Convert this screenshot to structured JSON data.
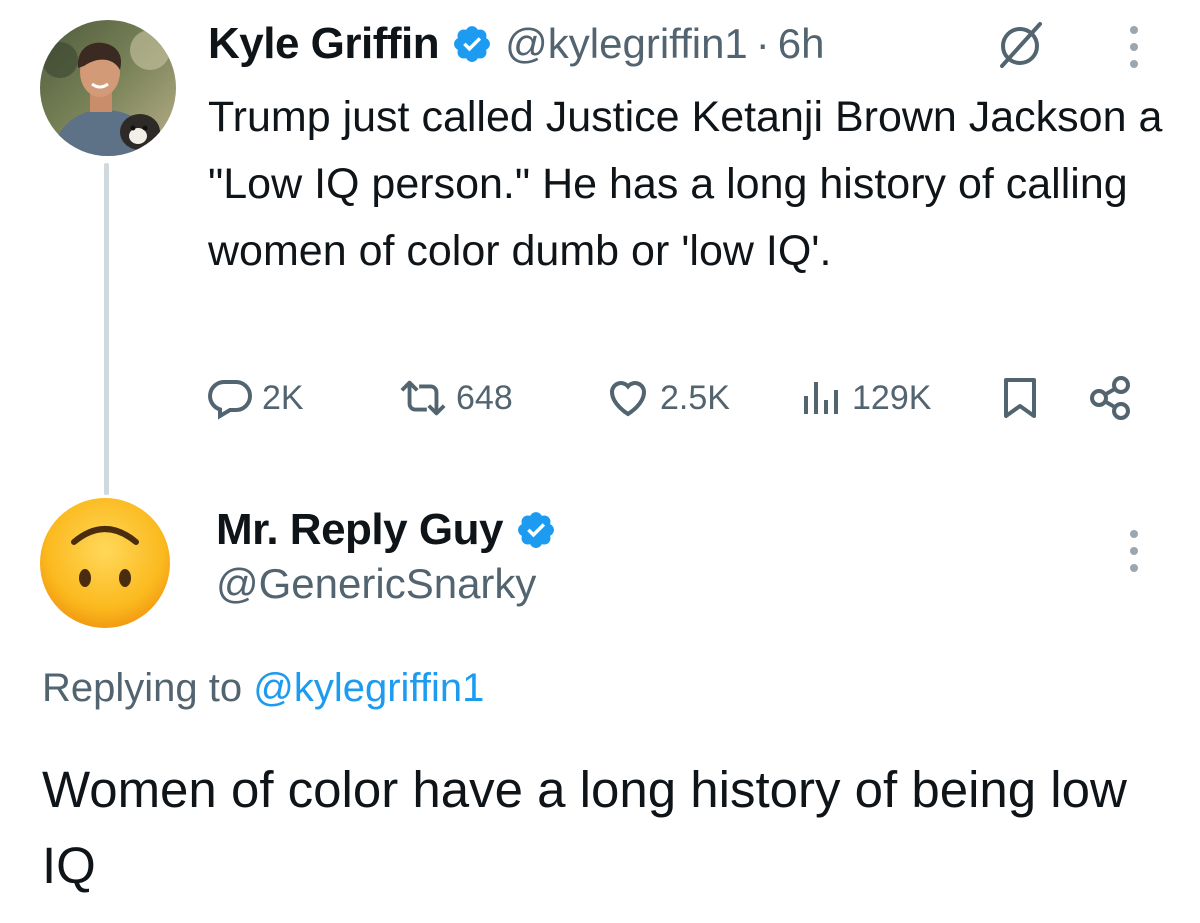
{
  "original_tweet": {
    "author": {
      "name": "Kyle Griffin",
      "verified": true,
      "handle": "@kylegriffin1",
      "time": "6h"
    },
    "text": "Trump just called Justice Ketanji Brown Jackson a \"Low IQ person.\" He has a long history of calling women of color dumb or 'low IQ'.",
    "actions": {
      "replies": "2K",
      "reposts": "648",
      "likes": "2.5K",
      "views": "129K"
    },
    "icons": [
      "reply-icon",
      "repost-icon",
      "like-icon",
      "views-icon",
      "bookmark-icon",
      "share-icon",
      "slash-circle-icon",
      "more-icon"
    ]
  },
  "reply_tweet": {
    "author": {
      "name": "Mr. Reply Guy",
      "verified": true,
      "handle": "@GenericSnarky",
      "avatar_icon": "upside-down-face-emoji"
    },
    "replying_to_prefix": "Replying to",
    "replying_to_handle": "@kylegriffin1",
    "text": "Women of color have a long history of being low IQ"
  },
  "colors": {
    "text": "#0f1419",
    "secondary": "#536471",
    "accent": "#1d9bf0",
    "thread_line": "#cfd9de"
  }
}
